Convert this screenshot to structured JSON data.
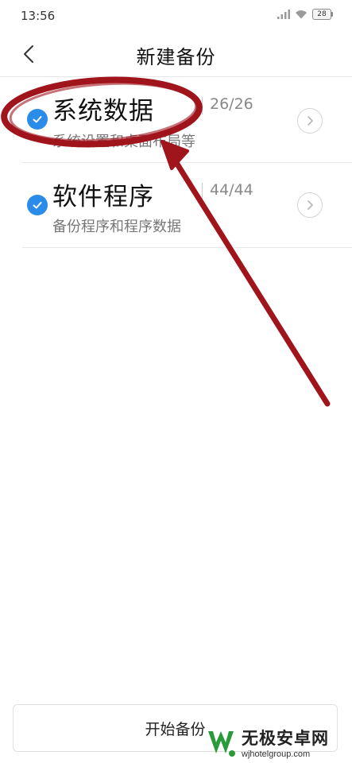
{
  "status_bar": {
    "time": "13:56",
    "battery": "28"
  },
  "header": {
    "title": "新建备份"
  },
  "items": [
    {
      "title": "系统数据",
      "count": "26/26",
      "description": "系统设置和桌面布局等",
      "checked": true
    },
    {
      "title": "软件程序",
      "count": "44/44",
      "description": "备份程序和程序数据",
      "checked": true
    }
  ],
  "footer": {
    "start_label": "开始备份"
  },
  "annotation": {
    "color": "#a0141c"
  },
  "colors": {
    "accent": "#2b8be8"
  },
  "watermark": {
    "name": "无极安卓网",
    "url": "wjhotelgroup.com"
  }
}
